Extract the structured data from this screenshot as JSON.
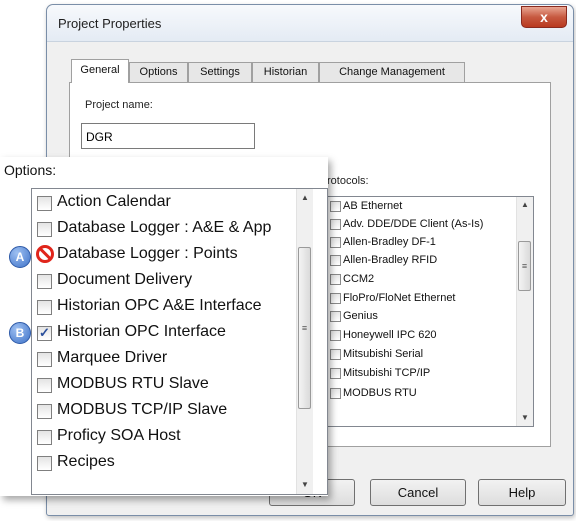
{
  "window": {
    "title": "Project Properties",
    "close_glyph": "x"
  },
  "tabs": [
    {
      "label": "General",
      "active": true
    },
    {
      "label": "Options",
      "active": false
    },
    {
      "label": "Settings",
      "active": false
    },
    {
      "label": "Historian",
      "active": false
    },
    {
      "label": "Change Management",
      "active": false
    }
  ],
  "general": {
    "project_name_label": "Project name:",
    "project_name_value": "DGR",
    "protocols_label": "rotocols:"
  },
  "protocols": [
    "AB Ethernet",
    "Adv. DDE/DDE Client (As-Is)",
    "Allen-Bradley DF-1",
    "Allen-Bradley RFID",
    "CCM2",
    "FloPro/FloNet Ethernet",
    "Genius",
    "Honeywell IPC 620",
    "Mitsubishi Serial",
    "Mitsubishi TCP/IP",
    "MODBUS RTU"
  ],
  "buttons": {
    "ok_partial": "OK",
    "cancel": "Cancel",
    "help": "Help"
  },
  "options_callout": {
    "title": "Options:",
    "items": [
      {
        "label": "Action Calendar",
        "state": "unchecked"
      },
      {
        "label": "Database Logger : A&E & App",
        "state": "unchecked"
      },
      {
        "label": "Database Logger : Points",
        "state": "blocked"
      },
      {
        "label": "Document Delivery",
        "state": "unchecked"
      },
      {
        "label": "Historian OPC A&E Interface",
        "state": "unchecked"
      },
      {
        "label": "Historian OPC Interface",
        "state": "checked"
      },
      {
        "label": "Marquee Driver",
        "state": "unchecked"
      },
      {
        "label": "MODBUS RTU Slave",
        "state": "unchecked"
      },
      {
        "label": "MODBUS TCP/IP Slave",
        "state": "unchecked"
      },
      {
        "label": "Proficy SOA Host",
        "state": "unchecked"
      },
      {
        "label": "Recipes",
        "state": "unchecked"
      }
    ]
  },
  "markers": {
    "a": "A",
    "b": "B"
  },
  "icons": {
    "checkbox": "checkbox-icon",
    "checkmark": "checkmark-icon",
    "blocked": "prohibited-icon",
    "scroll_up": "scroll-up-arrow-icon",
    "scroll_down": "scroll-down-arrow-icon"
  },
  "colors": {
    "accent_blue": "#3f73c8",
    "prohibited_red": "#e0251b",
    "close_red": "#c75a41"
  }
}
